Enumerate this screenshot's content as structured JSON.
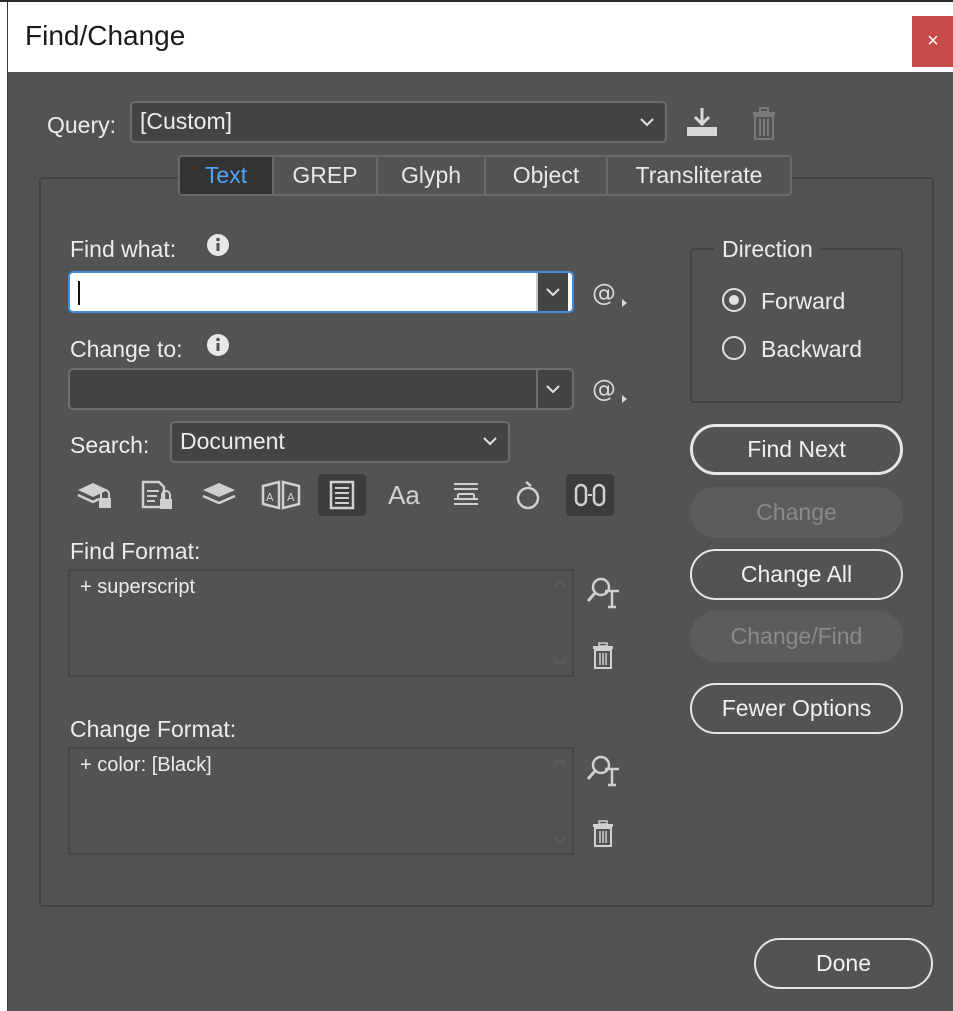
{
  "window": {
    "title": "Find/Change",
    "close_glyph": "×"
  },
  "query": {
    "label": "Query:",
    "value": "[Custom]",
    "save_icon": "save-query-icon",
    "delete_icon": "delete-query-icon"
  },
  "tabs": [
    {
      "label": "Text",
      "active": true
    },
    {
      "label": "GREP",
      "active": false
    },
    {
      "label": "Glyph",
      "active": false
    },
    {
      "label": "Object",
      "active": false
    },
    {
      "label": "Transliterate",
      "active": false
    }
  ],
  "find_what": {
    "label": "Find what:",
    "value": ""
  },
  "change_to": {
    "label": "Change to:",
    "value": ""
  },
  "search": {
    "label": "Search:",
    "value": "Document"
  },
  "search_options": [
    {
      "icon": "include-locked-layers-icon",
      "selected": false
    },
    {
      "icon": "include-locked-stories-icon",
      "selected": false
    },
    {
      "icon": "include-hidden-layers-icon",
      "selected": false
    },
    {
      "icon": "include-master-pages-icon",
      "selected": false
    },
    {
      "icon": "include-footnotes-icon",
      "selected": true
    },
    {
      "icon": "case-sensitive-icon",
      "label": "Aa",
      "selected": false
    },
    {
      "icon": "whole-word-icon",
      "selected": false
    },
    {
      "icon": "kana-sensitive-icon",
      "selected": false
    },
    {
      "icon": "full-half-width-sensitive-icon",
      "selected": true
    }
  ],
  "find_format": {
    "label": "Find Format:",
    "value": "+ superscript"
  },
  "change_format": {
    "label": "Change Format:",
    "value": "+ color: [Black]"
  },
  "direction": {
    "label": "Direction",
    "options": [
      {
        "label": "Forward",
        "selected": true
      },
      {
        "label": "Backward",
        "selected": false
      }
    ]
  },
  "buttons": {
    "find_next": "Find Next",
    "change": "Change",
    "change_all": "Change All",
    "change_find": "Change/Find",
    "fewer_options": "Fewer Options",
    "done": "Done"
  },
  "colors": {
    "dialog_bg": "#535353",
    "active_tab_text": "#4fa5f5",
    "close_button": "#c84b4b",
    "focus_border": "#3b8fdc"
  }
}
